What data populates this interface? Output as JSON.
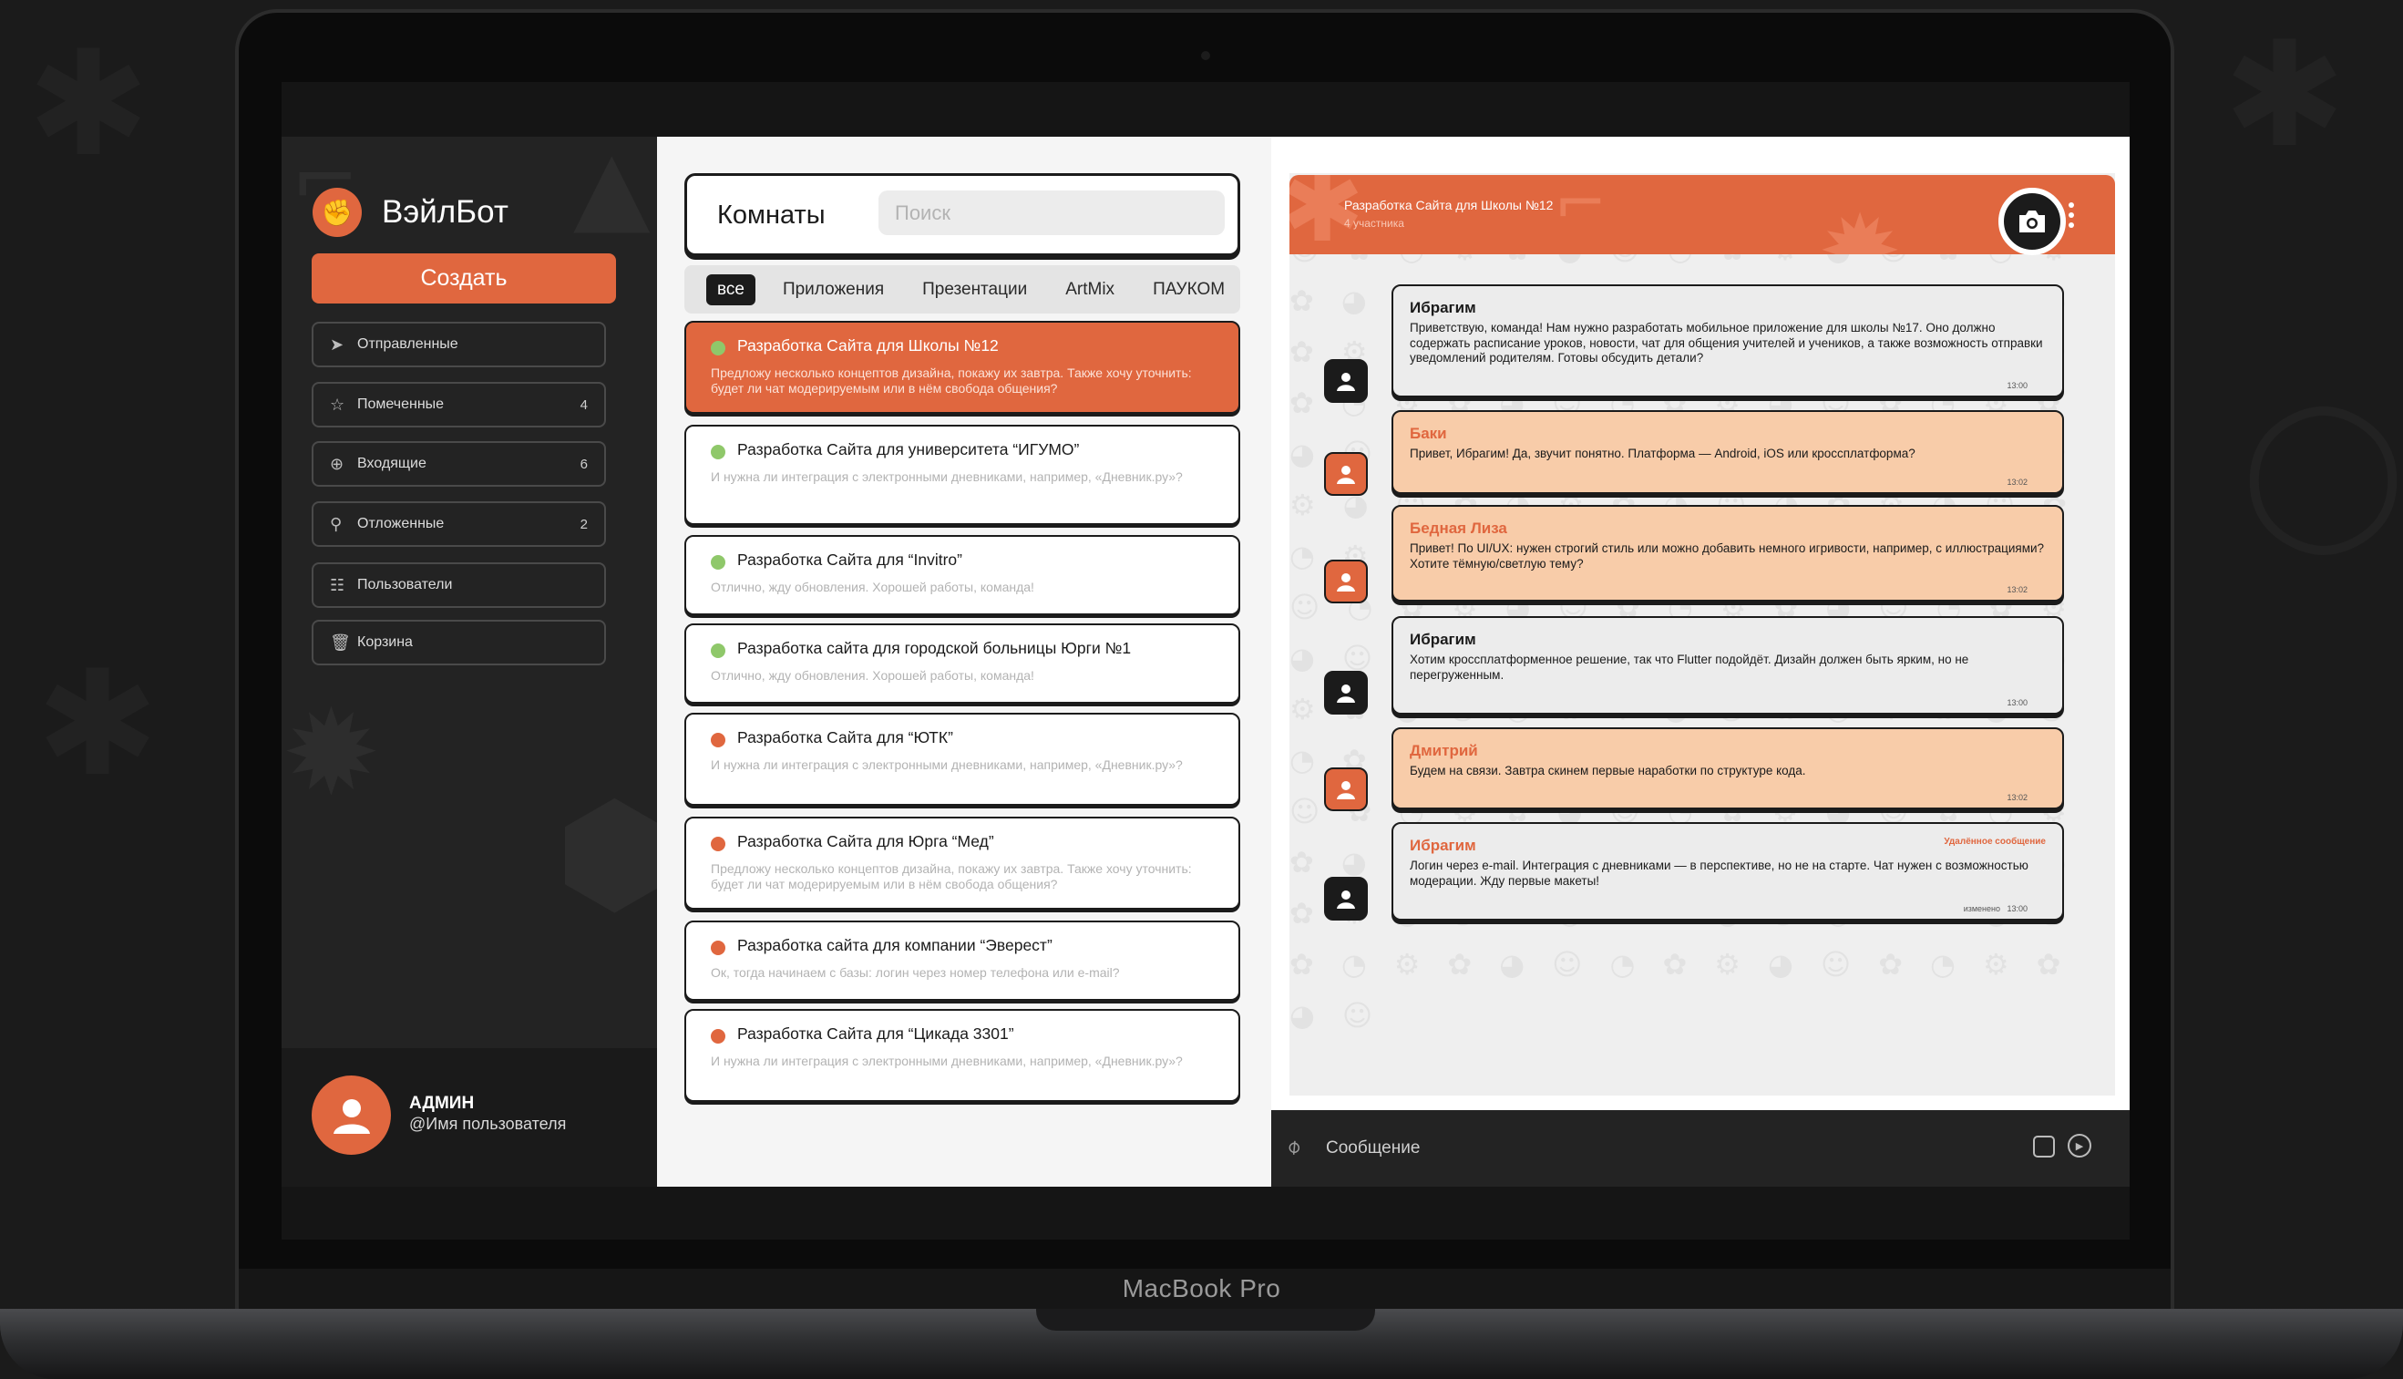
{
  "device": {
    "brand": "MacBook Pro"
  },
  "colors": {
    "accent": "#e0673f",
    "peach": "#f8cca9",
    "dark": "#232323",
    "online": "#8fc86a"
  },
  "sidebar": {
    "app_name": "ВэйлБот",
    "logo_icon": "fist-icon",
    "create_label": "Создать",
    "items": [
      {
        "label": "Отправленные",
        "icon": "send-icon",
        "count": ""
      },
      {
        "label": "Помеченные",
        "icon": "star-icon",
        "count": "4"
      },
      {
        "label": "Входящие",
        "icon": "inbox-icon",
        "count": "6"
      },
      {
        "label": "Отложенные",
        "icon": "pin-icon",
        "count": "2"
      },
      {
        "label": "Пользователи",
        "icon": "users-icon",
        "count": ""
      },
      {
        "label": "Корзина",
        "icon": "trash-icon",
        "count": ""
      }
    ],
    "profile": {
      "name": "АДМИН",
      "handle": "@Имя пользователя"
    }
  },
  "rooms": {
    "title": "Комнаты",
    "search_placeholder": "Поиск",
    "filters": [
      "все",
      "Приложения",
      "Презентации",
      "ArtMix",
      "ПАУКОМ"
    ],
    "active_filter": "все",
    "list": [
      {
        "title": "Разработка Сайта для Школы №12",
        "preview": "Предложу несколько концептов дизайна, покажу их завтра. Также хочу уточнить: будет ли чат модерируемым или в нём свобода общения?",
        "status": "online",
        "active": true
      },
      {
        "title": "Разработка Сайта  для университета “ИГУМО”",
        "preview": "И нужна ли интеграция с электронными дневниками, например, «Дневник.ру»?",
        "status": "online",
        "active": false
      },
      {
        "title": "Разработка Сайта для “Invitro”",
        "preview": "Отлично, жду обновления. Хорошей работы, команда!",
        "status": "online",
        "active": false
      },
      {
        "title": "Разработка сайта для городской больницы Юрги №1",
        "preview": "Отлично, жду обновления. Хорошей работы, команда!",
        "status": "online",
        "active": false
      },
      {
        "title": "Разработка Сайта для “ЮТК”",
        "preview": "И нужна ли интеграция с электронными дневниками, например, «Дневник.ру»?",
        "status": "busy",
        "active": false
      },
      {
        "title": "Разработка Сайта для Юрга “Мед”",
        "preview": "Предложу несколько концептов дизайна, покажу их завтра. Также хочу уточнить: будет ли чат модерируемым или в нём свобода общения?",
        "status": "busy",
        "active": false
      },
      {
        "title": "Разработка сайта для компании “Эверест”",
        "preview": "Ок, тогда начинаем с базы: логин через номер телефона или e-mail?",
        "status": "busy",
        "active": false
      },
      {
        "title": "Разработка Сайта для “Цикада 3301”",
        "preview": "И нужна ли интеграция с электронными дневниками, например, «Дневник.ру»?",
        "status": "busy",
        "active": false
      }
    ]
  },
  "chat": {
    "title": "Разработка Сайта для Школы №12",
    "members": "4 участника",
    "messages": [
      {
        "author": "Ибрагим",
        "text": "Приветствую, команда! Нам нужно разработать мобильное приложение для школы №17. Оно должно содержать расписание уроков, новости, чат для общения учителей и учеников, а также возможность отправки уведомлений родителям. Готовы обсудить детали?",
        "time": "13:00",
        "style": "grey",
        "avatar": "dark"
      },
      {
        "author": "Баки",
        "text": "Привет, Ибрагим! Да, звучит понятно. Платформа — Android, iOS или кроссплатформа?",
        "time": "13:02",
        "style": "peach",
        "avatar": "orange"
      },
      {
        "author": "Бедная  Лиза",
        "text": "Привет! По UI/UX: нужен строгий стиль или можно добавить немного игривости, например, с иллюстрациями? Хотите тёмную/светлую тему?",
        "time": "13:02",
        "style": "peach",
        "avatar": "orange"
      },
      {
        "author": "Ибрагим",
        "text": "Хотим кроссплатформенное решение, так что Flutter подойдёт. Дизайн должен быть ярким, но не перегруженным.",
        "time": "13:00",
        "style": "grey",
        "avatar": "dark"
      },
      {
        "author": "Дмитрий",
        "text": "Будем на связи. Завтра скинем первые наработки по структуре кода.",
        "time": "13:02",
        "style": "peach",
        "avatar": "orange"
      },
      {
        "author": "Ибрагим",
        "text": "Логин через e-mail. Интеграция с дневниками — в перспективе, но не на старте. Чат нужен с возможностью модерации. Жду первые макеты!",
        "time": "13:00",
        "style": "grey",
        "avatar": "dark",
        "deleted_label": "Удалённое сообщение",
        "edited_label": "изменено"
      }
    ],
    "composer_placeholder": "Сообщение"
  }
}
